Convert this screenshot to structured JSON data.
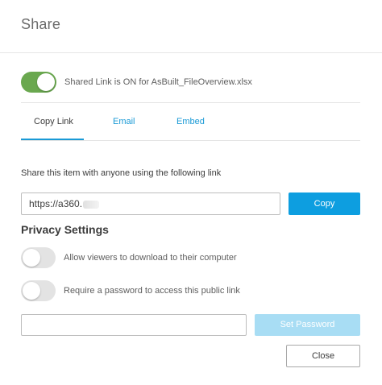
{
  "dialog": {
    "title": "Share"
  },
  "shared_link": {
    "label": "Shared Link is ON for AsBuilt_FileOverview.xlsx",
    "enabled": true,
    "color_on": "#6aa84f"
  },
  "tabs": [
    {
      "label": "Copy Link",
      "active": true
    },
    {
      "label": "Email",
      "active": false
    },
    {
      "label": "Embed",
      "active": false
    }
  ],
  "copy_link": {
    "description": "Share this item with anyone using the following link",
    "link_value": "https://a360.",
    "copy_label": "Copy",
    "accent": "#0d9ee0"
  },
  "privacy": {
    "heading": "Privacy Settings",
    "download_label": "Allow viewers to download to their computer",
    "download_enabled": false,
    "password_label": "Require a password to access this public link",
    "password_enabled": false,
    "password_value": "",
    "set_password_label": "Set Password"
  },
  "footer": {
    "close_label": "Close"
  }
}
